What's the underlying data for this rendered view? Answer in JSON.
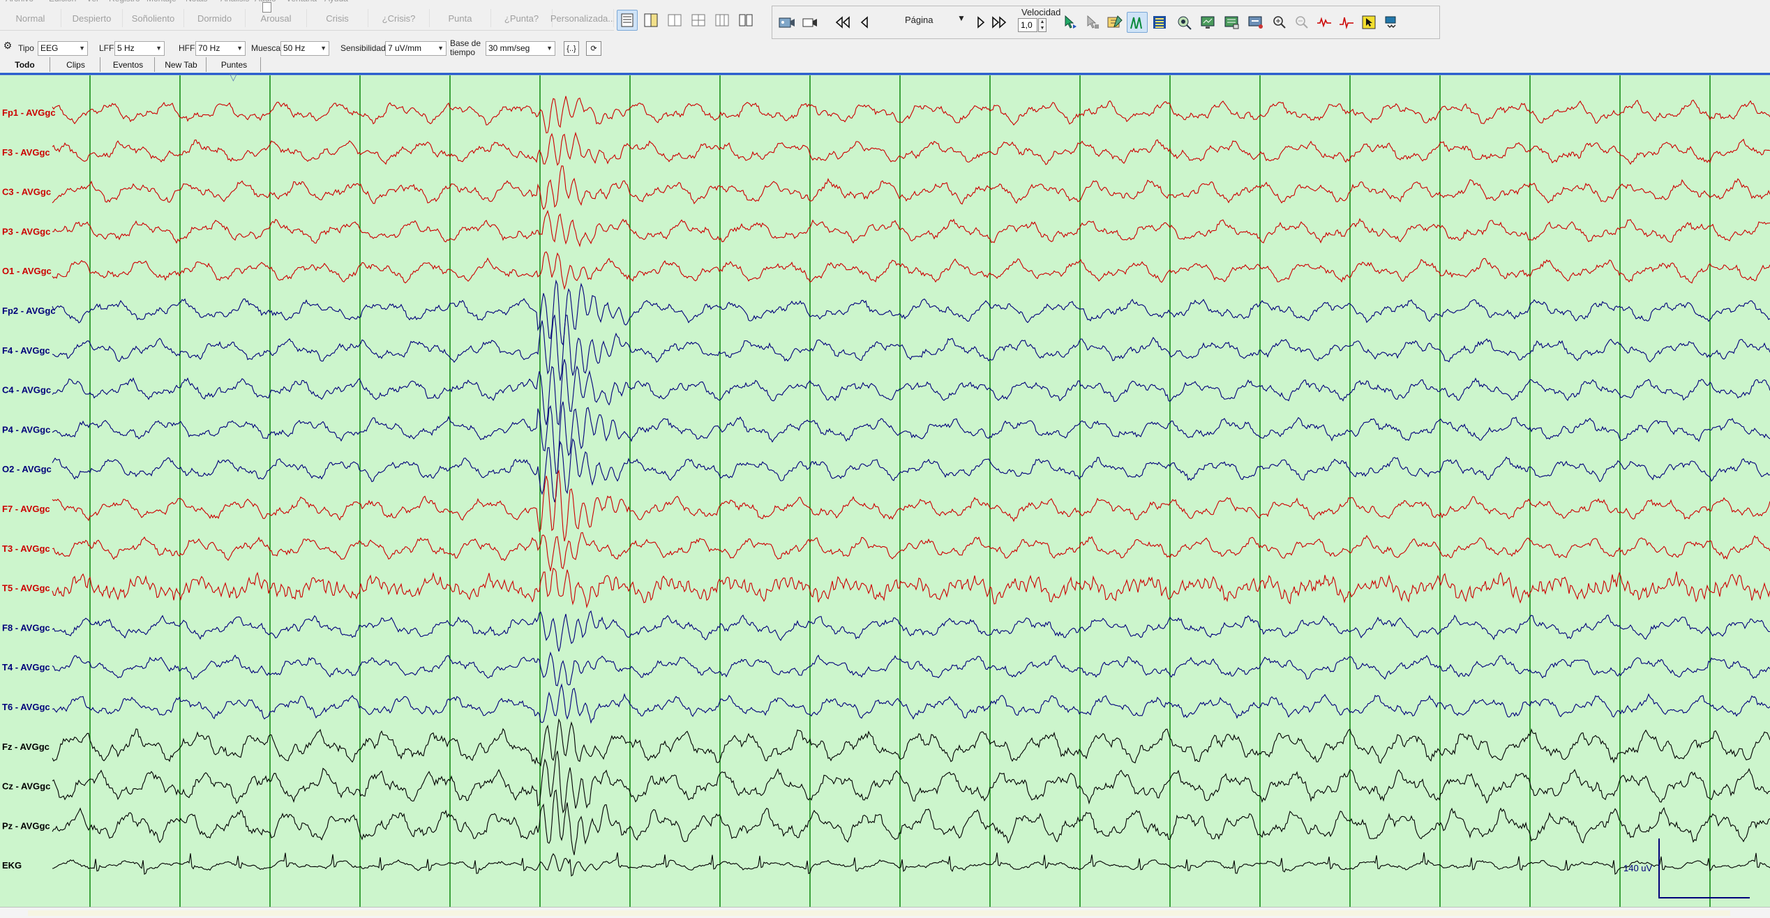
{
  "menu_items": [
    "Archivo",
    "Edición",
    "Ver",
    "Registro",
    "Montaje",
    "Notas",
    "Análisis",
    "Audio",
    "Ventana",
    "Ayuda"
  ],
  "events": [
    "Normal",
    "Despierto",
    "Soñoliento",
    "Dormido",
    "Arousal",
    "Crisis",
    "¿Crisis?",
    "Punta",
    "¿Punta?",
    "Personalizada..."
  ],
  "toolbar": {
    "page_label": "Página",
    "speed_label": "Velocidad",
    "speed_value": "1,0"
  },
  "filters": {
    "tipo_label": "Tipo",
    "tipo_value": "EEG",
    "lff_label": "LFF",
    "lff_value": "5 Hz",
    "hff_label": "HFF",
    "hff_value": "70 Hz",
    "muesca_label": "Muesca",
    "muesca_value": "50 Hz",
    "sensibilidad_label": "Sensibilidad",
    "sensibilidad_value": "7 uV/mm",
    "base_label": "Base de tiempo",
    "base_value": "30 mm/seg"
  },
  "tabs": [
    "Todo",
    "Clips",
    "Eventos",
    "New Tab",
    "Puntes"
  ],
  "active_tab": "Todo",
  "colors": {
    "background": "#ccf5cc",
    "gridline": "#008000",
    "left_channels": "#cc0000",
    "right_channels": "#00007a",
    "midline_channels": "#000000",
    "top_border": "#1e4fd0"
  },
  "channels": [
    {
      "label": "Fp1 - AVGgc",
      "color": "red"
    },
    {
      "label": "F3 - AVGgc",
      "color": "red"
    },
    {
      "label": "C3 - AVGgc",
      "color": "red"
    },
    {
      "label": "P3 - AVGgc",
      "color": "red"
    },
    {
      "label": "O1 - AVGgc",
      "color": "red"
    },
    {
      "label": "Fp2 - AVGgc",
      "color": "blue"
    },
    {
      "label": "F4 - AVGgc",
      "color": "blue"
    },
    {
      "label": "C4 - AVGgc",
      "color": "blue"
    },
    {
      "label": "P4 - AVGgc",
      "color": "blue"
    },
    {
      "label": "O2 - AVGgc",
      "color": "blue"
    },
    {
      "label": "F7 - AVGgc",
      "color": "red"
    },
    {
      "label": "T3 - AVGgc",
      "color": "red"
    },
    {
      "label": "T5 - AVGgc",
      "color": "red"
    },
    {
      "label": "F8 - AVGgc",
      "color": "blue"
    },
    {
      "label": "T4 - AVGgc",
      "color": "blue"
    },
    {
      "label": "T6 - AVGgc",
      "color": "blue"
    },
    {
      "label": "Fz - AVGgc",
      "color": "black"
    },
    {
      "label": "Cz - AVGgc",
      "color": "black"
    },
    {
      "label": "Pz - AVGgc",
      "color": "black"
    },
    {
      "label": "EKG",
      "color": "black"
    }
  ],
  "calibration_label": "140 uV"
}
